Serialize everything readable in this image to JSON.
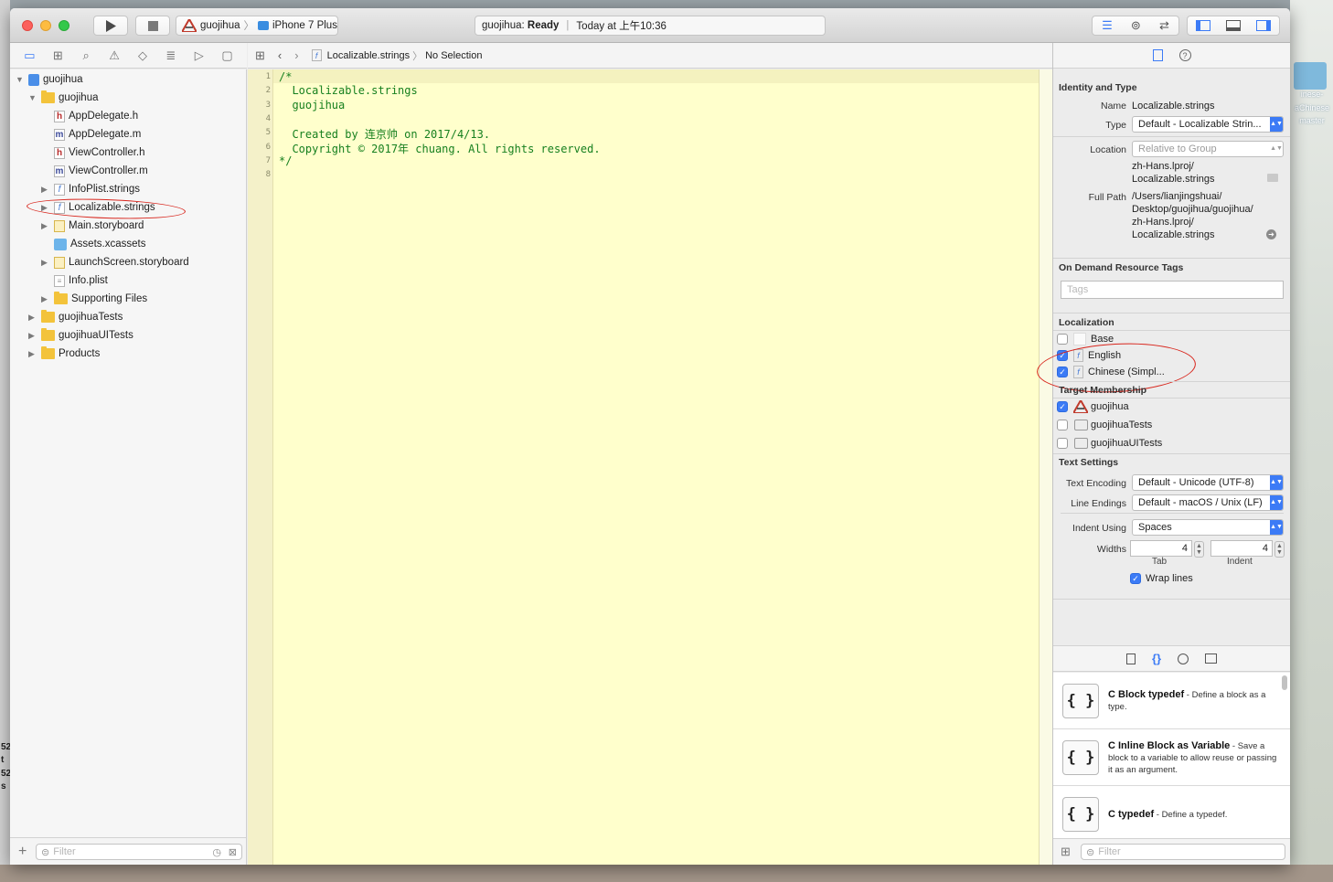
{
  "window": {
    "scheme_target": "guojihua",
    "device": "iPhone 7 Plus",
    "activity": {
      "project": "guojihua:",
      "status": "Ready",
      "time": "Today at 上午10:36"
    }
  },
  "navigator": {
    "items": [
      {
        "label": "guojihua",
        "kind": "project"
      },
      {
        "label": "guojihua",
        "kind": "group"
      },
      {
        "label": "AppDelegate.h",
        "kind": "h"
      },
      {
        "label": "AppDelegate.m",
        "kind": "m"
      },
      {
        "label": "ViewController.h",
        "kind": "h"
      },
      {
        "label": "ViewController.m",
        "kind": "m"
      },
      {
        "label": "InfoPlist.strings",
        "kind": "strings"
      },
      {
        "label": "Localizable.strings",
        "kind": "strings"
      },
      {
        "label": "Main.storyboard",
        "kind": "storyboard"
      },
      {
        "label": "Assets.xcassets",
        "kind": "assets"
      },
      {
        "label": "LaunchScreen.storyboard",
        "kind": "storyboard"
      },
      {
        "label": "Info.plist",
        "kind": "plist"
      },
      {
        "label": "Supporting Files",
        "kind": "group"
      },
      {
        "label": "guojihuaTests",
        "kind": "group"
      },
      {
        "label": "guojihuaUITests",
        "kind": "group"
      },
      {
        "label": "Products",
        "kind": "group"
      }
    ],
    "filter_placeholder": "Filter"
  },
  "editor": {
    "breadcrumb_file": "Localizable.strings",
    "breadcrumb_selection": "No Selection",
    "line_numbers": [
      "1",
      "2",
      "3",
      "4",
      "5",
      "6",
      "7",
      "8"
    ],
    "lines": [
      "/*",
      "  Localizable.strings",
      "  guojihua",
      "",
      "  Created by 连京帅 on 2017/4/13.",
      "  Copyright © 2017年 chuang. All rights reserved.",
      "*/",
      ""
    ]
  },
  "inspector": {
    "identity": {
      "title": "Identity and Type",
      "name_label": "Name",
      "name_value": "Localizable.strings",
      "type_label": "Type",
      "type_value": "Default - Localizable Strin...",
      "location_label": "Location",
      "location_value": "Relative to Group",
      "location_path_1": "zh-Hans.lproj/",
      "location_path_2": "Localizable.strings",
      "fullpath_label": "Full Path",
      "fullpath_1": "/Users/lianjingshuai/",
      "fullpath_2": "Desktop/guojihua/guojihua/",
      "fullpath_3": "zh-Hans.lproj/",
      "fullpath_4": "Localizable.strings"
    },
    "tags": {
      "title": "On Demand Resource Tags",
      "placeholder": "Tags"
    },
    "localization": {
      "title": "Localization",
      "items": [
        {
          "label": "Base",
          "checked": false
        },
        {
          "label": "English",
          "checked": true
        },
        {
          "label": "Chinese (Simpl...",
          "checked": true
        }
      ]
    },
    "membership": {
      "title": "Target Membership",
      "items": [
        {
          "label": "guojihua",
          "checked": true
        },
        {
          "label": "guojihuaTests",
          "checked": false
        },
        {
          "label": "guojihuaUITests",
          "checked": false
        }
      ]
    },
    "text_settings": {
      "title": "Text Settings",
      "encoding_label": "Text Encoding",
      "encoding_value": "Default - Unicode (UTF-8)",
      "endings_label": "Line Endings",
      "endings_value": "Default - macOS / Unix (LF)",
      "indent_label": "Indent Using",
      "indent_value": "Spaces",
      "widths_label": "Widths",
      "tab_value": "4",
      "indent_width_value": "4",
      "tab_caption": "Tab",
      "indent_caption": "Indent",
      "wrap_label": "Wrap lines",
      "wrap_checked": true
    },
    "library": {
      "items": [
        {
          "title": "C Block typedef",
          "desc": " - Define a block as a type."
        },
        {
          "title": "C Inline Block as Variable",
          "desc": " - Save a block to a variable to allow reuse or passing it as an argument."
        },
        {
          "title": "C typedef",
          "desc": " - Define a typedef."
        }
      ],
      "filter_placeholder": "Filter"
    }
  },
  "desktop": {
    "icon_label_1": "inese-",
    "icon_label_2": "aChinese",
    "icon_label_3": "master",
    "side_1": "52",
    "side_2": "t",
    "side_3": "52",
    "side_4": "s"
  },
  "colors": {
    "accent": "#3c7bf6",
    "code": "#17801f",
    "editor_bg": "#ffffcc",
    "annotation": "#d8251c"
  }
}
